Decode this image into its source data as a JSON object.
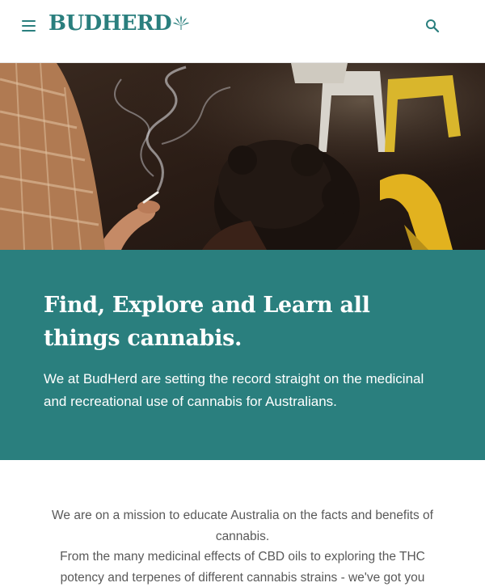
{
  "header": {
    "logo_text": "BUDHERD",
    "menu_icon": "hamburger-menu-icon",
    "search_icon": "search-icon",
    "logo_icon": "cannabis-leaf-icon"
  },
  "hero": {
    "image_alt": "Woman holding smoking joint with chairs in background"
  },
  "banner": {
    "heading": "Find, Explore and Learn all things cannabis.",
    "subtext": "We at BudHerd are setting the record straight on the medicinal and recreational use of cannabis for Australians."
  },
  "mission": {
    "paragraph_1": "We are on a mission to educate Australia on the facts and benefits of cannabis.",
    "paragraph_2": "From the many medicinal effects of CBD oils to exploring the THC potency and terpenes of different cannabis strains - we've got you"
  },
  "colors": {
    "brand": "#2a7f7e",
    "text_muted": "#595959",
    "white": "#ffffff"
  }
}
